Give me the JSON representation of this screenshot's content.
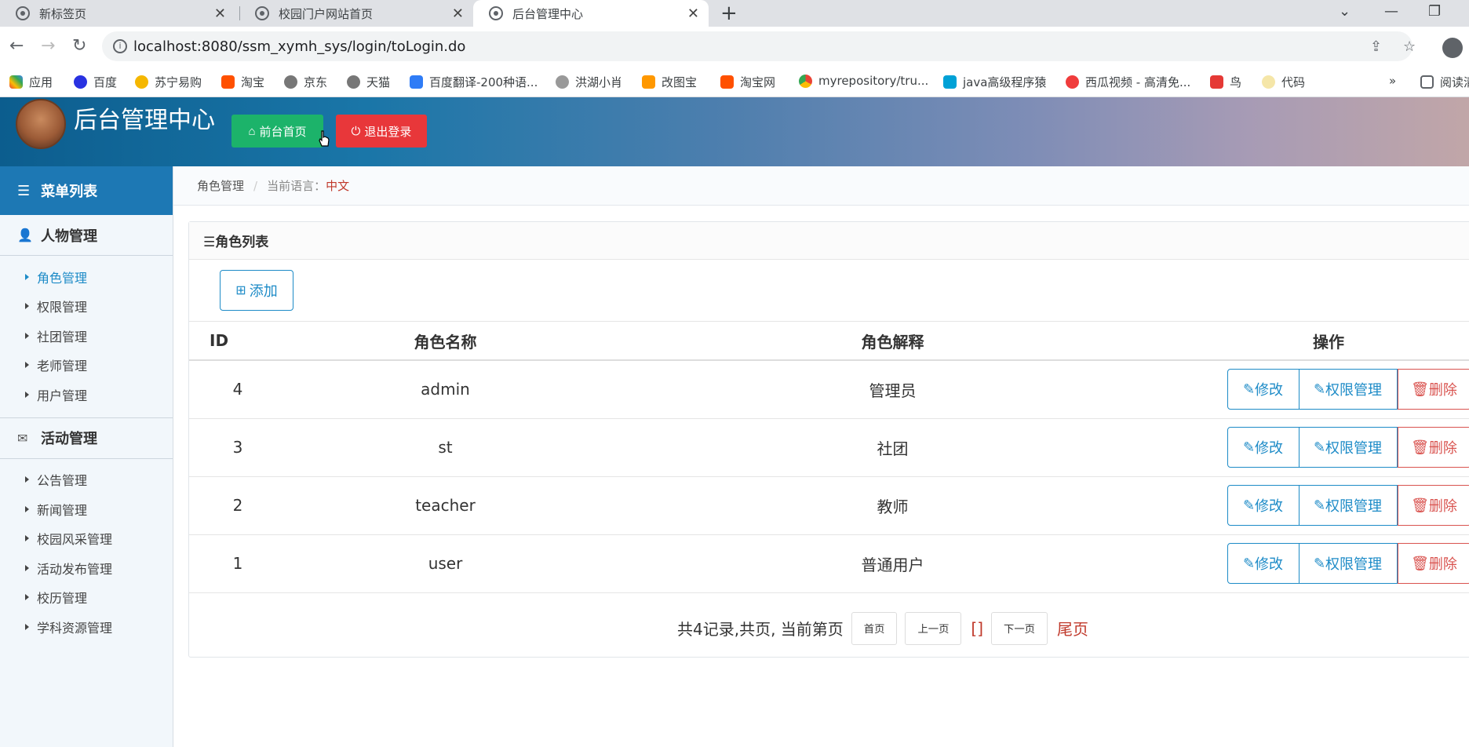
{
  "browser": {
    "tabs": [
      {
        "title": "新标签页"
      },
      {
        "title": "校园门户网站首页"
      },
      {
        "title": "后台管理中心"
      }
    ],
    "url": "localhost:8080/ssm_xymh_sys/login/toLogin.do",
    "bookmarks": [
      "应用",
      "百度",
      "苏宁易购",
      "淘宝",
      "京东",
      "天猫",
      "百度翻译-200种语...",
      "洪湖小肖",
      "改图宝",
      "淘宝网",
      "myrepository/tru...",
      "java高级程序猿",
      "西瓜视频 - 高清免...",
      "鸟",
      "代码",
      "阅读清"
    ]
  },
  "header": {
    "title": "后台管理中心",
    "home_label": "前台首页",
    "logout_label": "退出登录"
  },
  "sidebar": {
    "title": "菜单列表",
    "groups": [
      {
        "label": "人物管理",
        "items": [
          "角色管理",
          "权限管理",
          "社团管理",
          "老师管理",
          "用户管理"
        ]
      },
      {
        "label": "活动管理",
        "items": [
          "公告管理",
          "新闻管理",
          "校园风采管理",
          "活动发布管理",
          "校历管理",
          "学科资源管理"
        ]
      }
    ]
  },
  "breadcrumb": {
    "current": "角色管理",
    "lang_label": "当前语言：",
    "lang_value": "中文"
  },
  "panel": {
    "title": "☰角色列表",
    "add_label": "添加",
    "headers": [
      "ID",
      "角色名称",
      "角色解释",
      "操作"
    ],
    "rows": [
      {
        "id": "4",
        "name": "admin",
        "desc": "管理员"
      },
      {
        "id": "3",
        "name": "st",
        "desc": "社团"
      },
      {
        "id": "2",
        "name": "teacher",
        "desc": "教师"
      },
      {
        "id": "1",
        "name": "user",
        "desc": "普通用户"
      }
    ],
    "edit_label": "修改",
    "perm_label": "权限管理",
    "delete_label": "删除"
  },
  "pager": {
    "summary": "共4记录,共页, 当前第页",
    "first": "首页",
    "prev": "上一页",
    "current": "[]",
    "next": "下一页",
    "last": "尾页"
  },
  "colors": {
    "accent": "#1d8bc7",
    "sidebar_top": "#1d78b4",
    "danger": "#d9534f",
    "success": "#1cb36a"
  }
}
